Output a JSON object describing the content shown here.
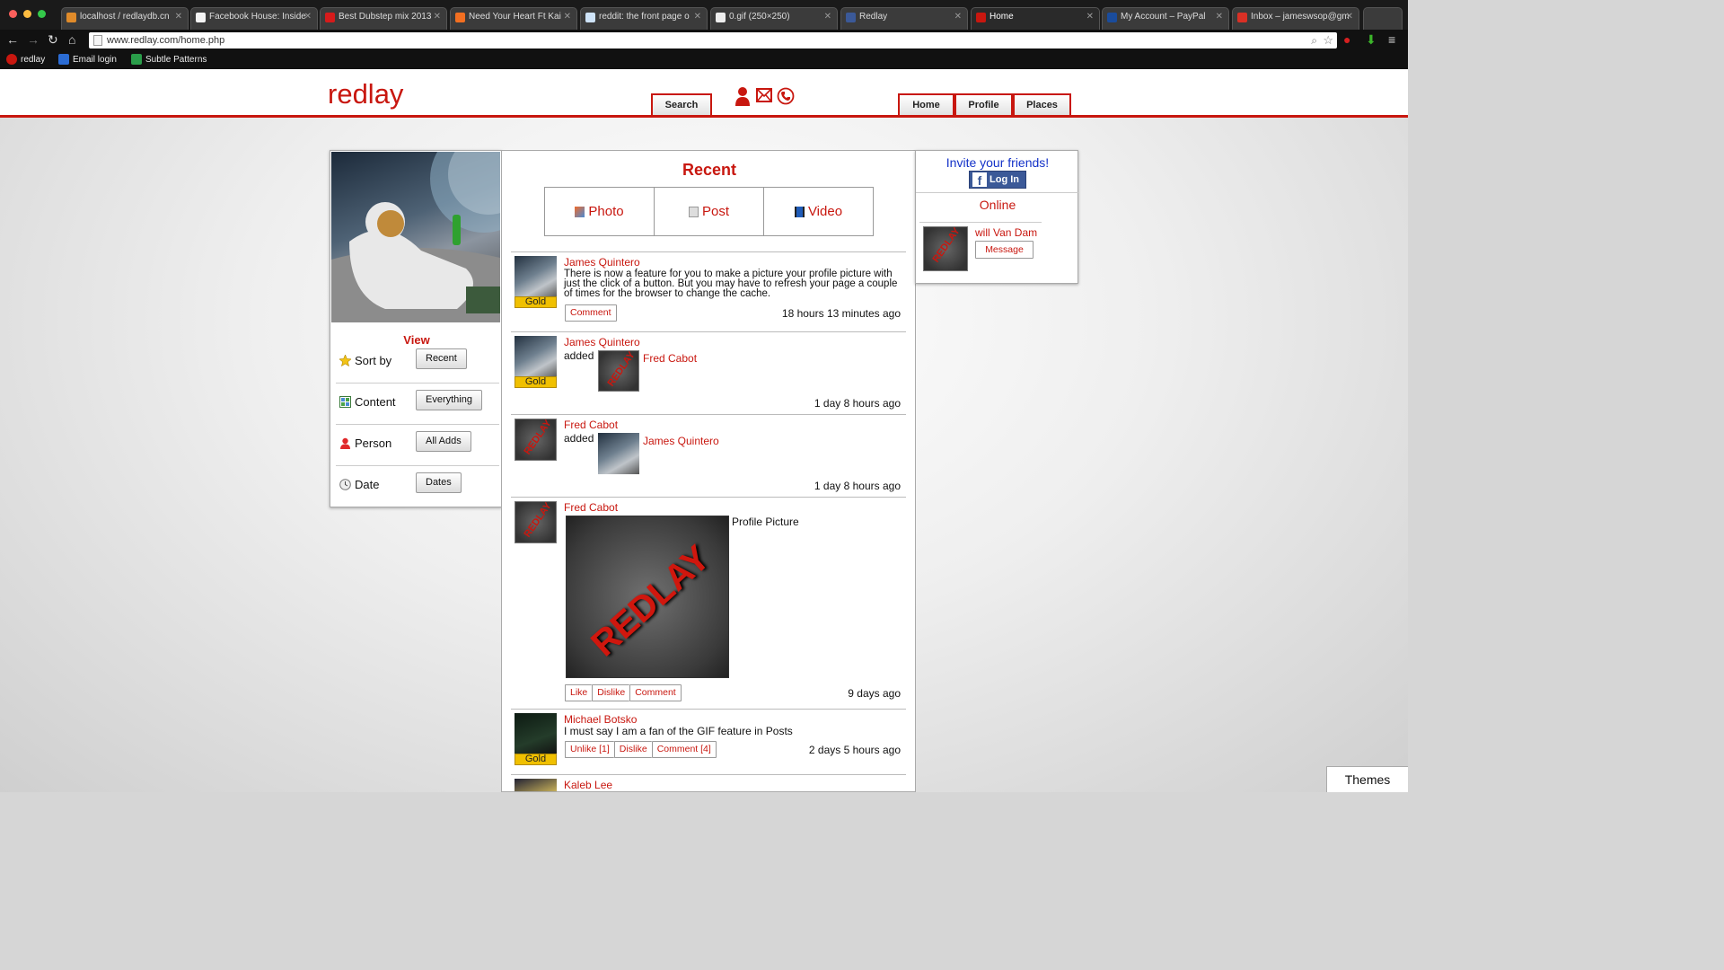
{
  "browser": {
    "tabs": [
      {
        "title": "localhost / redlaydb.cn",
        "favicon_color": "#e08b2a"
      },
      {
        "title": "Facebook House: Inside",
        "favicon_color": "#f4f4f4"
      },
      {
        "title": "Best Dubstep mix 2013",
        "favicon_color": "#d61b1b"
      },
      {
        "title": "Need Your Heart Ft Kai",
        "favicon_color": "#f26f21"
      },
      {
        "title": "reddit: the front page o",
        "favicon_color": "#cee3f8"
      },
      {
        "title": "0.gif (250×250)",
        "favicon_color": "#eeeeee"
      },
      {
        "title": "Redlay",
        "favicon_color": "#3b5998"
      },
      {
        "title": "Home",
        "favicon_color": "#c8170f",
        "active": true
      },
      {
        "title": "My Account – PayPal",
        "favicon_color": "#1a4c9c"
      },
      {
        "title": "Inbox – jameswsop@gm",
        "favicon_color": "#d93025"
      }
    ],
    "url": "www.redlay.com/home.php",
    "bookmarks": [
      {
        "label": "redlay",
        "icon": "redlay-icon",
        "color": "#c8170f"
      },
      {
        "label": "Email login",
        "icon": "email-icon",
        "color": "#2b6cd4"
      },
      {
        "label": "Subtle Patterns",
        "icon": "pattern-icon",
        "color": "#2a9d4a"
      }
    ]
  },
  "header": {
    "logo": "redlay",
    "search_label": "Search",
    "nav": [
      "Home",
      "Profile",
      "Places"
    ]
  },
  "sidebar": {
    "view_title": "View",
    "rows": [
      {
        "label": "Sort by",
        "button": "Recent",
        "icon": "star-icon"
      },
      {
        "label": "Content",
        "button": "Everything",
        "icon": "grid-icon"
      },
      {
        "label": "Person",
        "button": "All Adds",
        "icon": "person-icon"
      },
      {
        "label": "Date",
        "button": "Dates",
        "icon": "clock-icon"
      }
    ]
  },
  "feed": {
    "title": "Recent",
    "types": [
      "Photo",
      "Post",
      "Video"
    ],
    "posts": [
      {
        "author": "James Quintero",
        "badge": "Gold",
        "text": "There is now a feature for you to make a picture your profile picture with just the click of a button. But you may have to refresh your page a couple of times for the browser to change the cache.",
        "actions": [
          "Comment"
        ],
        "time": "18 hours 13 minutes ago"
      },
      {
        "author": "James Quintero",
        "badge": "Gold",
        "verb": "added",
        "target": "Fred Cabot",
        "time": "1 day 8 hours ago"
      },
      {
        "author": "Fred Cabot",
        "verb": "added",
        "target": "James Quintero",
        "time": "1 day 8 hours ago"
      },
      {
        "author": "Fred Cabot",
        "caption": "Profile Picture",
        "image_text": "REDLAY",
        "actions": [
          "Like",
          "Dislike",
          "Comment"
        ],
        "time": "9 days ago"
      },
      {
        "author": "Michael Botsko",
        "badge": "Gold",
        "text": "I must say I am a fan of the GIF feature in Posts",
        "actions": [
          "Unlike [1]",
          "Dislike",
          "Comment [4]"
        ],
        "time": "2 days 5 hours ago"
      },
      {
        "author": "Kaleb Lee"
      }
    ]
  },
  "right": {
    "invite": "Invite your friends!",
    "fb_login": "Log In",
    "online_title": "Online",
    "online_user": "will Van Dam",
    "message_btn": "Message"
  },
  "themes_label": "Themes",
  "avatar_text": "REDLAY",
  "colors": {
    "brand": "#c8170f",
    "gold": "#f0c000",
    "invite": "#1432c8",
    "facebook": "#3b5998"
  }
}
